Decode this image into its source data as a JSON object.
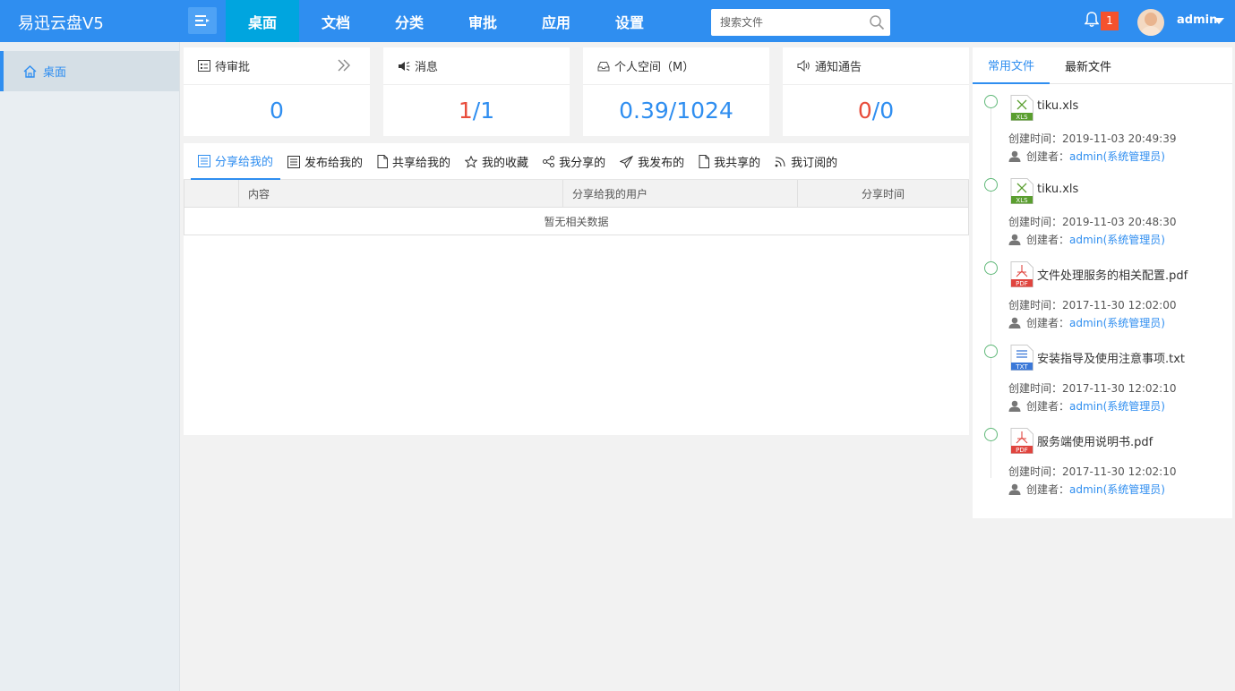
{
  "app": {
    "title": "易迅云盘V5"
  },
  "nav": {
    "items": [
      "桌面",
      "文档",
      "分类",
      "审批",
      "应用",
      "设置"
    ],
    "active_index": 0
  },
  "search": {
    "placeholder": "搜索文件"
  },
  "header": {
    "notification_count": "1",
    "username": "admin"
  },
  "sidebar": {
    "items": [
      {
        "label": "桌面",
        "icon": "home-icon"
      }
    ]
  },
  "stats": {
    "pending": {
      "label": "待审批",
      "value": "0"
    },
    "messages": {
      "label": "消息",
      "value_a": "1",
      "sep": "/",
      "value_b": "1"
    },
    "space": {
      "label": "个人空间（M）",
      "value": "0.39/1024"
    },
    "notices": {
      "label": "通知通告",
      "value_a": "0",
      "sep": "/",
      "value_b": "0"
    }
  },
  "tabs": {
    "items": [
      {
        "label": "分享给我的",
        "icon": "list-icon"
      },
      {
        "label": "发布给我的",
        "icon": "list-icon"
      },
      {
        "label": "共享给我的",
        "icon": "file-icon"
      },
      {
        "label": "我的收藏",
        "icon": "star-icon"
      },
      {
        "label": "我分享的",
        "icon": "share-icon"
      },
      {
        "label": "我发布的",
        "icon": "send-icon"
      },
      {
        "label": "我共享的",
        "icon": "file-icon"
      },
      {
        "label": "我订阅的",
        "icon": "rss-icon"
      }
    ],
    "active_index": 0
  },
  "table": {
    "columns": [
      "",
      "内容",
      "分享给我的用户",
      "分享时间"
    ],
    "empty_text": "暂无相关数据"
  },
  "right_panel": {
    "tabs": [
      "常用文件",
      "最新文件"
    ],
    "active_index": 0,
    "created_label": "创建时间：",
    "creator_label": "创建者：",
    "files": [
      {
        "name": "tiku.xls",
        "type": "XLS",
        "created": "2019-11-03 20:49:39",
        "creator": "admin(系统管理员)",
        "color": "#5a9e2f"
      },
      {
        "name": "tiku.xls",
        "type": "XLS",
        "created": "2019-11-03 20:48:30",
        "creator": "admin(系统管理员)",
        "color": "#5a9e2f"
      },
      {
        "name": "文件处理服务的相关配置.pdf",
        "type": "PDF",
        "created": "2017-11-30 12:02:00",
        "creator": "admin(系统管理员)",
        "color": "#e0443e"
      },
      {
        "name": "安装指导及使用注意事项.txt",
        "type": "TXT",
        "created": "2017-11-30 12:02:10",
        "creator": "admin(系统管理员)",
        "color": "#3b78d8"
      },
      {
        "name": "服务端使用说明书.pdf",
        "type": "PDF",
        "created": "2017-11-30 12:02:10",
        "creator": "admin(系统管理员)",
        "color": "#e0443e"
      }
    ]
  }
}
